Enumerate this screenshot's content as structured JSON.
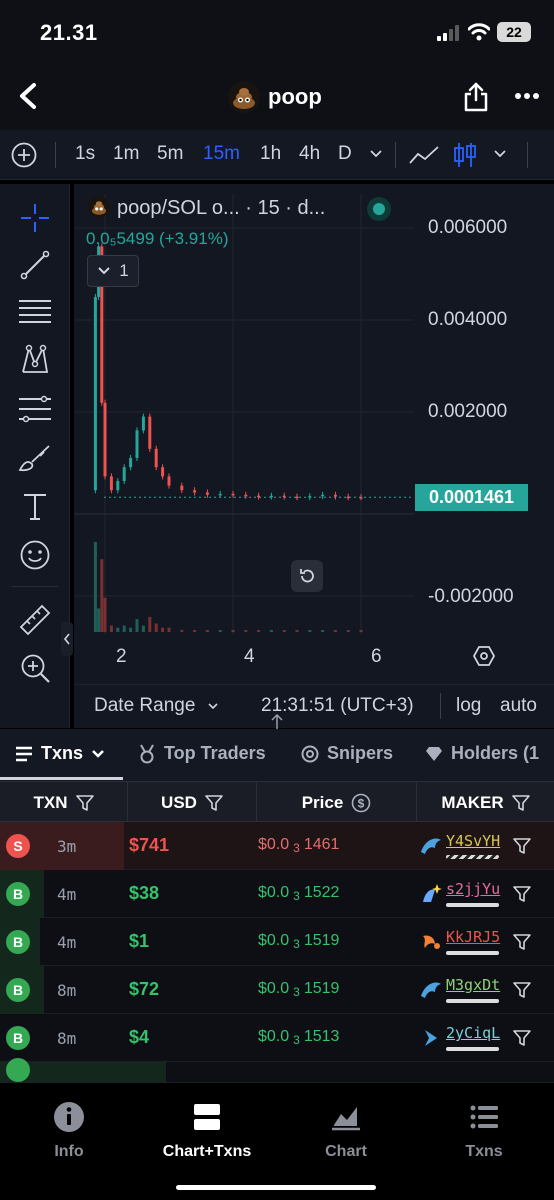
{
  "status_bar": {
    "time": "21.31",
    "battery": "22"
  },
  "header": {
    "token_name": "poop"
  },
  "timeframes": {
    "items": [
      "1s",
      "1m",
      "5m",
      "15m",
      "1h",
      "4h",
      "D"
    ],
    "active": "15m"
  },
  "chart": {
    "legend_title": "poop/SOL o... · 15 · d...",
    "legend_price": "0.0₅5499 (+3.91%)",
    "indicator_count": "1",
    "y_ticks": [
      "0.006000",
      "0.004000",
      "0.002000",
      "-0.002000"
    ],
    "current_price_tag": "0.0001461",
    "x_ticks": [
      "2",
      "4",
      "6"
    ],
    "date_range_label": "Date Range",
    "clock": "21:31:51 (UTC+3)",
    "log_label": "log",
    "auto_label": "auto",
    "colors": {
      "up": "#26a69a",
      "down": "#ef5350",
      "background": "#131722"
    }
  },
  "chart_data": {
    "type": "line",
    "title": "",
    "xlabel": "",
    "ylabel": "",
    "x": [
      1.8,
      1.85,
      1.9,
      1.95,
      2.0,
      2.1,
      2.2,
      2.3,
      2.4,
      2.5,
      2.6,
      2.7,
      2.8,
      2.9,
      3.0,
      3.2,
      3.4,
      3.6,
      3.8,
      4.0,
      4.2,
      4.4,
      4.6,
      4.8,
      5.0,
      5.2,
      5.4,
      5.6,
      5.8,
      6.0
    ],
    "series": [
      {
        "values": [
          0.0003,
          0.0045,
          0.0056,
          0.0022,
          0.0006,
          0.0003,
          0.0005,
          0.0008,
          0.001,
          0.0016,
          0.0019,
          0.0012,
          0.0008,
          0.0006,
          0.0004,
          0.0003,
          0.00025,
          0.0002,
          0.00022,
          0.0002,
          0.00018,
          0.00016,
          0.00018,
          0.00016,
          0.00015,
          0.00017,
          0.0002,
          0.00016,
          0.00015,
          0.0001461
        ]
      }
    ],
    "ylim": [
      -0.0025,
      0.0065
    ],
    "xlim": [
      1.7,
      6.6
    ],
    "grid": true
  },
  "tabs": [
    {
      "label": "Txns",
      "active": true
    },
    {
      "label": "Top Traders",
      "active": false
    },
    {
      "label": "Snipers",
      "active": false
    },
    {
      "label": "Holders (1",
      "active": false
    }
  ],
  "table": {
    "headers": {
      "txn": "TXN",
      "usd": "USD",
      "price": "Price",
      "maker": "MAKER"
    },
    "rows": [
      {
        "type": "S",
        "age": "3m",
        "usd": "$741",
        "price_prefix": "$0.0",
        "price_sub": "3",
        "price_rest": "1461",
        "maker": "Y4SvYH",
        "side": "sell",
        "icon": "dolphin-icon"
      },
      {
        "type": "B",
        "age": "4m",
        "usd": "$38",
        "price_prefix": "$0.0",
        "price_sub": "3",
        "price_rest": "1522",
        "maker": "s2jjYu",
        "side": "buy",
        "icon": "sparkle-shrimp-icon"
      },
      {
        "type": "B",
        "age": "4m",
        "usd": "$1",
        "price_prefix": "$0.0",
        "price_sub": "3",
        "price_rest": "1519",
        "maker": "KkJRJ5",
        "side": "buy",
        "icon": "shrimp-icon"
      },
      {
        "type": "B",
        "age": "8m",
        "usd": "$72",
        "price_prefix": "$0.0",
        "price_sub": "3",
        "price_rest": "1519",
        "maker": "M3gxDt",
        "side": "buy",
        "icon": "dolphin-icon"
      },
      {
        "type": "B",
        "age": "8m",
        "usd": "$4",
        "price_prefix": "$0.0",
        "price_sub": "3",
        "price_rest": "1513",
        "maker": "2yCiqL",
        "side": "buy",
        "icon": "fish-icon"
      }
    ]
  },
  "nav": [
    {
      "label": "Info",
      "icon": "info-icon"
    },
    {
      "label": "Chart+Txns",
      "icon": "split-view-icon",
      "active": true
    },
    {
      "label": "Chart",
      "icon": "chart-icon"
    },
    {
      "label": "Txns",
      "icon": "list-icon"
    }
  ]
}
